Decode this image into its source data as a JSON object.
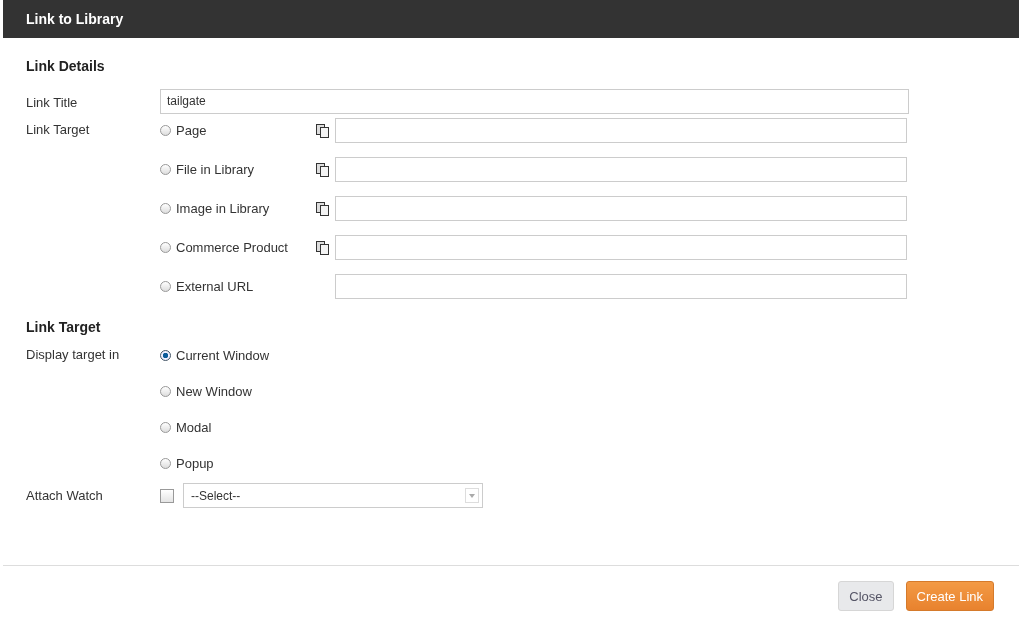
{
  "window": {
    "title": "Link to Library"
  },
  "details": {
    "heading": "Link Details",
    "title_label": "Link Title",
    "title_value": "tailgate",
    "target_label": "Link Target",
    "targets": [
      {
        "label": "Page",
        "selected": false,
        "kind": "picker"
      },
      {
        "label": "File in Library",
        "selected": false,
        "kind": "picker"
      },
      {
        "label": "Image in Library",
        "selected": false,
        "kind": "picker"
      },
      {
        "label": "Commerce Product",
        "selected": false,
        "kind": "picker"
      },
      {
        "label": "External URL",
        "selected": false,
        "kind": "text"
      }
    ]
  },
  "display": {
    "heading": "Link Target",
    "label": "Display target in",
    "options": [
      {
        "label": "Current Window",
        "selected": true
      },
      {
        "label": "New Window",
        "selected": false
      },
      {
        "label": "Modal",
        "selected": false
      },
      {
        "label": "Popup",
        "selected": false
      }
    ]
  },
  "watch": {
    "label": "Attach Watch",
    "checked": false,
    "select_value": "--Select--"
  },
  "buttons": [
    {
      "label": "Close",
      "kind": "secondary"
    },
    {
      "label": "Create Link",
      "kind": "primary"
    }
  ]
}
